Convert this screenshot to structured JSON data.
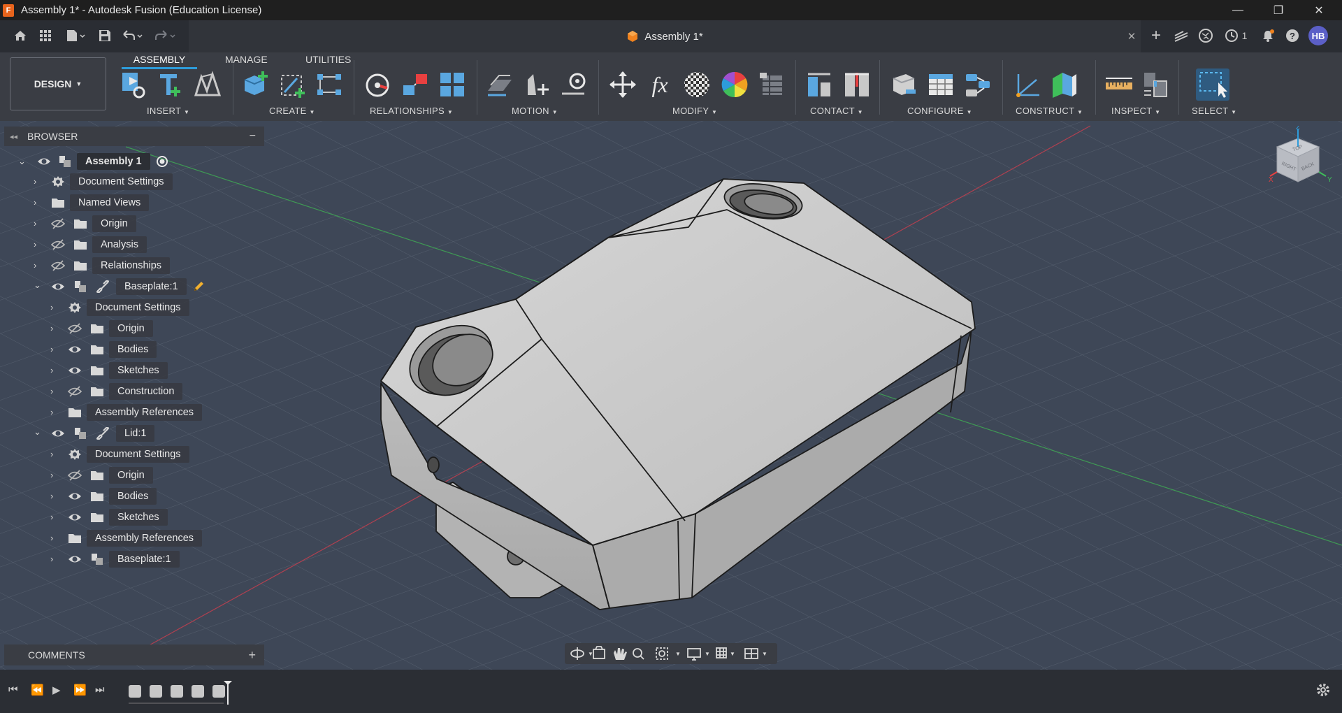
{
  "window": {
    "title": "Assembly 1* - Autodesk Fusion (Education License)",
    "app_icon_letter": "F"
  },
  "document_tab": {
    "label": "Assembly 1*"
  },
  "quickbar": {
    "job_count": "1",
    "user_initials": "HB"
  },
  "workspace": {
    "label": "DESIGN"
  },
  "ribbon_tabs": [
    "ASSEMBLY",
    "MANAGE",
    "UTILITIES"
  ],
  "ribbon_groups": [
    "INSERT",
    "CREATE",
    "RELATIONSHIPS",
    "MOTION",
    "MODIFY",
    "CONTACT",
    "CONFIGURE",
    "CONSTRUCT",
    "INSPECT",
    "SELECT"
  ],
  "browser": {
    "title": "BROWSER",
    "root": "Assembly 1",
    "items": [
      "Document Settings",
      "Named Views",
      "Origin",
      "Analysis",
      "Relationships",
      "Baseplate:1",
      "Document Settings",
      "Origin",
      "Bodies",
      "Sketches",
      "Construction",
      "Assembly References",
      "Lid:1",
      "Document Settings",
      "Origin",
      "Bodies",
      "Sketches",
      "Assembly References",
      "Baseplate:1"
    ]
  },
  "comments": {
    "title": "COMMENTS"
  },
  "viewcube": {
    "face_right": "RIGHT",
    "face_back": "BACK",
    "face_top": "TOP",
    "axis_z": "Z",
    "axis_x": "X",
    "axis_y": "Y"
  },
  "colors": {
    "accent": "#2d9cdb",
    "background": "#3e4757",
    "panel": "#3a3d44",
    "avatar": "#5b5fc7"
  }
}
